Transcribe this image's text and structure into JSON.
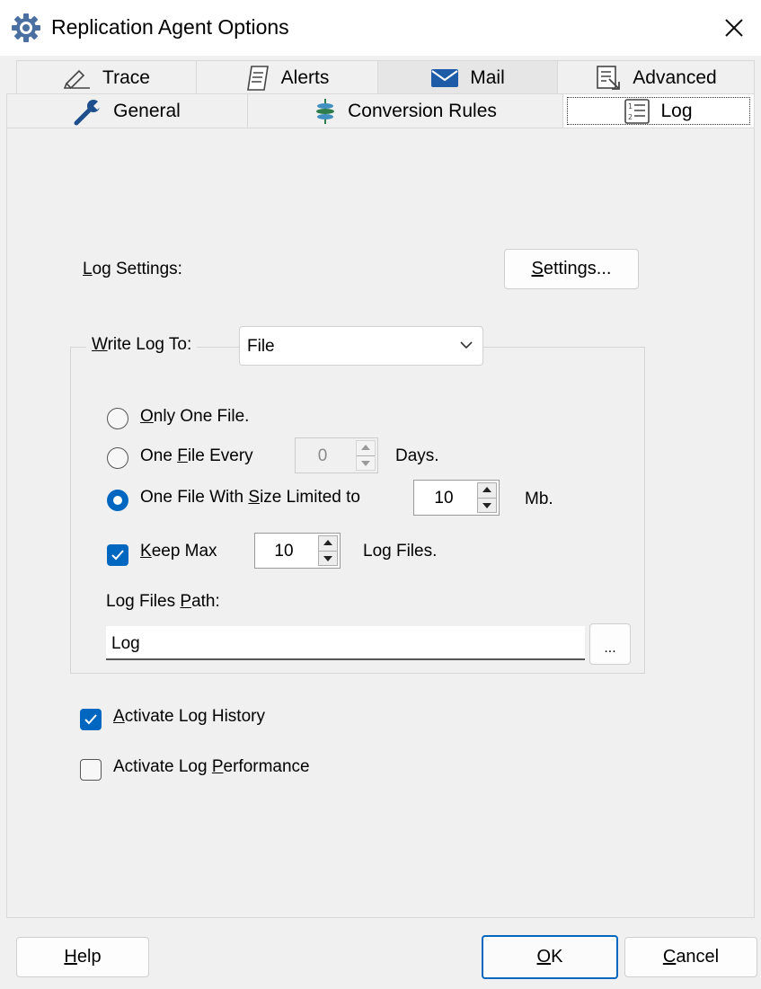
{
  "window": {
    "title": "Replication Agent Options",
    "title_icon": "gear-icon",
    "close_icon": "close-icon"
  },
  "tabs": {
    "row_top": [
      {
        "label": "Trace",
        "icon": "pen-icon"
      },
      {
        "label": "Alerts",
        "icon": "script-icon"
      },
      {
        "label": "Mail",
        "icon": "envelope-icon"
      },
      {
        "label": "Advanced",
        "icon": "settings-document-icon"
      }
    ],
    "row_bottom": [
      {
        "label": "General",
        "icon": "wrench-icon"
      },
      {
        "label": "Conversion Rules",
        "icon": "conversion-icon"
      },
      {
        "label": "Log",
        "icon": "numbered-list-icon",
        "active": true
      }
    ]
  },
  "log_settings": {
    "label_prefix": "",
    "label_mnemonic": "L",
    "label_rest": "og Settings:",
    "button_mnemonic": "S",
    "button_rest": "ettings..."
  },
  "write_log": {
    "label_mnemonic": "W",
    "label_rest": "rite Log To:",
    "selected": "File"
  },
  "options": {
    "only_one_file": {
      "mnemonic": "O",
      "rest": "nly One File.",
      "selected": false
    },
    "one_file_every": {
      "pre": "One ",
      "mnemonic": "F",
      "rest": "ile Every",
      "value": "0",
      "unit": "Days.",
      "selected": false
    },
    "size_limited": {
      "pre": "One File With ",
      "mnemonic": "S",
      "rest": "ize Limited to",
      "value": "10",
      "unit": "Mb.",
      "selected": true
    },
    "keep_max": {
      "mnemonic": "K",
      "rest": "eep Max",
      "value": "10",
      "unit": "Log Files.",
      "checked": true
    }
  },
  "log_path": {
    "label_pre": "Log Files ",
    "label_mnemonic": "P",
    "label_rest": "ath:",
    "value": "Log",
    "browse_label": "..."
  },
  "history": {
    "mnemonic": "A",
    "rest": "ctivate Log History",
    "checked": true
  },
  "performance": {
    "pre": "Activate Log ",
    "mnemonic": "P",
    "rest": "erformance",
    "checked": false
  },
  "footer": {
    "help": {
      "mnemonic": "H",
      "rest": "elp"
    },
    "ok": {
      "mnemonic": "O",
      "rest": "K"
    },
    "cancel": {
      "mnemonic": "C",
      "rest": "ancel"
    }
  },
  "colors": {
    "accent": "#0067c0",
    "background": "#f0f0f0"
  }
}
